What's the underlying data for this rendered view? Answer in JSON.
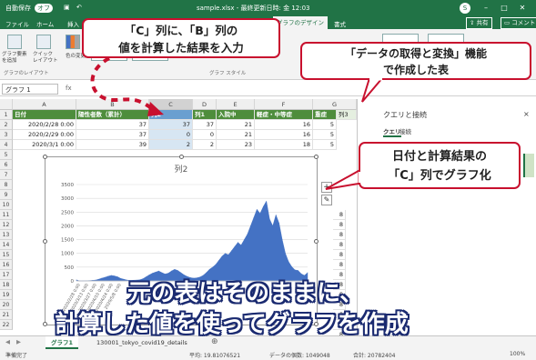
{
  "titlebar": {
    "autosave": "自動保存",
    "autosave_state": "オフ",
    "doc_title": "sample.xlsx - 最終更新日時: 金 12:03",
    "user_initial": "S"
  },
  "ribbon": {
    "tabs": [
      "ファイル",
      "ホーム",
      "挿入",
      "グラフのデザイン",
      "書式"
    ],
    "active_tab": "グラフのデザイン",
    "share": "共有",
    "comment": "コメント",
    "btn_add_element": "グラフ要素を追加",
    "btn_quick_layout": "クイック レイアウト",
    "btn_colors": "色の変更",
    "group_layout": "グラフのレイアウト",
    "group_styles": "グラフ スタイル"
  },
  "formula_bar": {
    "name_box": "グラフ 1"
  },
  "grid": {
    "columns": [
      "A",
      "B",
      "C",
      "D",
      "E",
      "F",
      "G"
    ],
    "row_numbers": [
      "1",
      "2",
      "3",
      "4",
      "5",
      "6",
      "7",
      "8",
      "9",
      "10",
      "11",
      "12",
      "13",
      "14",
      "15",
      "16",
      "17",
      "18",
      "19",
      "20",
      "21",
      "22"
    ],
    "header_row": [
      "日付",
      "陽性者数（累計）",
      "列2",
      "列1",
      "入院中",
      "軽症・中等症",
      "重症",
      "列3"
    ],
    "rows": [
      [
        "2020/2/28 0:00",
        "37",
        "37",
        "37",
        "21",
        "16",
        "5"
      ],
      [
        "2020/2/29 0:00",
        "37",
        "0",
        "0",
        "21",
        "16",
        "5"
      ],
      [
        "2020/3/1 0:00",
        "39",
        "2",
        "2",
        "23",
        "18",
        "5"
      ]
    ],
    "right_col_values": [
      "8",
      "8",
      "8",
      "8",
      "8",
      "8",
      "8",
      "8",
      "8",
      "8",
      "8",
      "8",
      "8"
    ]
  },
  "chart_data": {
    "type": "area",
    "title": "列2",
    "xlabel": "",
    "ylabel": "",
    "ylim": [
      0,
      3500
    ],
    "yticks": [
      "0",
      "500",
      "1000",
      "1500",
      "2000",
      "2500",
      "3000",
      "3500"
    ],
    "xtick_labels": [
      "2020/2/28 0:00",
      "2020/3/13 0:00",
      "2020/3/27 0:00",
      "2020/4/10 0:00",
      "2020/4/24 0:00",
      "2020/5/8 0:00"
    ],
    "color": "#4472c4",
    "series": [
      {
        "values": [
          37,
          0,
          2,
          5,
          10,
          20,
          30,
          60,
          100,
          130,
          170,
          200,
          180,
          150,
          90,
          60,
          30,
          20,
          25,
          30,
          40,
          80,
          150,
          220,
          280,
          320,
          360,
          300,
          250,
          280,
          360,
          420,
          380,
          300,
          220,
          160,
          120,
          100,
          110,
          140,
          200,
          300,
          420,
          500,
          600,
          750,
          900,
          1000,
          950,
          1100,
          1250,
          1400,
          1300,
          1500,
          1700,
          2000,
          2300,
          2600,
          2450,
          2700,
          2900,
          2250,
          2000,
          2400,
          2100,
          1500,
          1000,
          700,
          520,
          400,
          380,
          260,
          200,
          300
        ]
      }
    ]
  },
  "pane": {
    "title": "クエリと接続",
    "tab_query": "クエリ",
    "tab_connection": "接続",
    "close": "×"
  },
  "sheet_tabs": [
    "グラフ1",
    "130001_tokyo_covid19_details"
  ],
  "status": {
    "ready": "準備完了",
    "average": "平均: 19.81076521",
    "count": "データの個数: 1049048",
    "sum": "合計: 20782404",
    "zoom": "100%"
  },
  "callouts": {
    "c_col": "「C」列に、「B」列の\n値を計算した結果を入力",
    "table": "「データの取得と変換」機能\nで作成した表",
    "chart": "日付と計算結果の\n「C」列でグラフ化"
  },
  "caption": {
    "line1": "元の表はそのままに、",
    "line2": "計算した値を使ってグラフを作成"
  },
  "colors": {
    "excel_green": "#217346",
    "table_header": "#4e8d3c",
    "callout_border": "#c8102e",
    "caption_outline": "#1a2a70"
  }
}
